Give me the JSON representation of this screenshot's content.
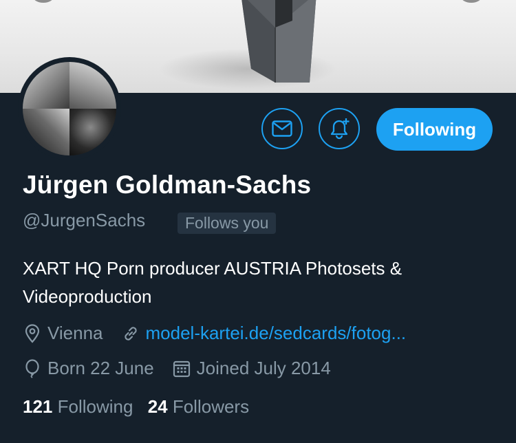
{
  "profile": {
    "display_name": "Jürgen Goldman-Sachs",
    "handle": "@JurgenSachs",
    "follows_you_badge": "Follows you",
    "bio": "XART HQ Porn producer AUSTRIA Photosets & Videoproduction",
    "location": "Vienna",
    "website": "model-kartei.de/sedcards/fotog...",
    "birthday": "Born 22 June",
    "joined": "Joined July 2014"
  },
  "actions": {
    "following_label": "Following",
    "message_icon": "envelope-icon",
    "notify_icon": "bell-plus-icon"
  },
  "stats": {
    "following_count": "121",
    "following_label": "Following",
    "followers_count": "24",
    "followers_label": "Followers"
  },
  "colors": {
    "background": "#15202b",
    "accent": "#1da1f2",
    "secondary_text": "#8899a6",
    "badge_bg": "#253341"
  }
}
